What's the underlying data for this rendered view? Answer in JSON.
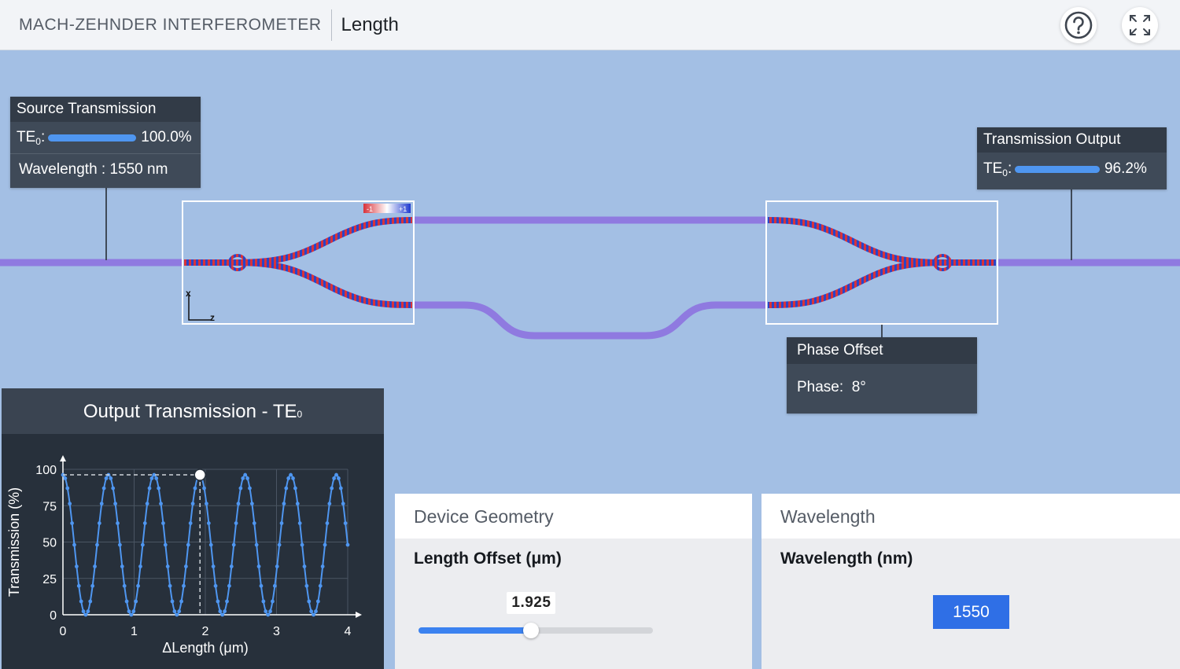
{
  "header": {
    "app_title": "MACH-ZEHNDER INTERFEROMETER",
    "page_title": "Length",
    "help_icon": "help-circle-icon",
    "expand_icon": "fullscreen-icon"
  },
  "source_panel": {
    "title": "Source Transmission",
    "mode_label": "TE",
    "mode_sub": "0",
    "mode_suffix": ":",
    "percent_text": "100.0%",
    "percent_value": 100.0,
    "wavelength_text": "Wavelength : 1550 nm"
  },
  "output_panel": {
    "title": "Transmission Output",
    "mode_label": "TE",
    "mode_sub": "0",
    "mode_suffix": ":",
    "percent_text": "96.2%",
    "percent_value": 96.2
  },
  "phase_panel": {
    "title": "Phase Offset",
    "label": "Phase:",
    "value": "8°"
  },
  "field_colorbar": {
    "min_label": "-1",
    "max_label": "+1"
  },
  "axes_indicator": {
    "x": "x",
    "z": "z"
  },
  "chart": {
    "title": "Output Transmission - TE",
    "title_sub": "0"
  },
  "chart_data": {
    "type": "line",
    "title": "Output Transmission - TE0",
    "xlabel": "ΔLength (μm)",
    "ylabel": "Transmission (%)",
    "xlim": [
      0,
      4
    ],
    "ylim": [
      0,
      100
    ],
    "x_ticks": [
      "0",
      "1",
      "2",
      "3",
      "4"
    ],
    "y_ticks": [
      "0",
      "25",
      "50",
      "75",
      "100"
    ],
    "grid": true,
    "series_color": "#4f96f0",
    "period_um": 0.64,
    "first_min_um": 0.32,
    "max_percent": 96.2,
    "min_percent": 0,
    "marker": {
      "x": 1.925,
      "y": 96.2
    }
  },
  "geometry": {
    "header": "Device Geometry",
    "label": "Length Offset (μm)",
    "value_text": "1.925",
    "value": 1.925,
    "min": 0,
    "max": 4
  },
  "wavelength": {
    "header": "Wavelength",
    "label": "Wavelength (nm)",
    "value": "1550"
  },
  "colors": {
    "waveguide": "#8f7ae0",
    "field_red": "#d8323a",
    "field_blue": "#2a44c8",
    "accent": "#3b82f0"
  }
}
